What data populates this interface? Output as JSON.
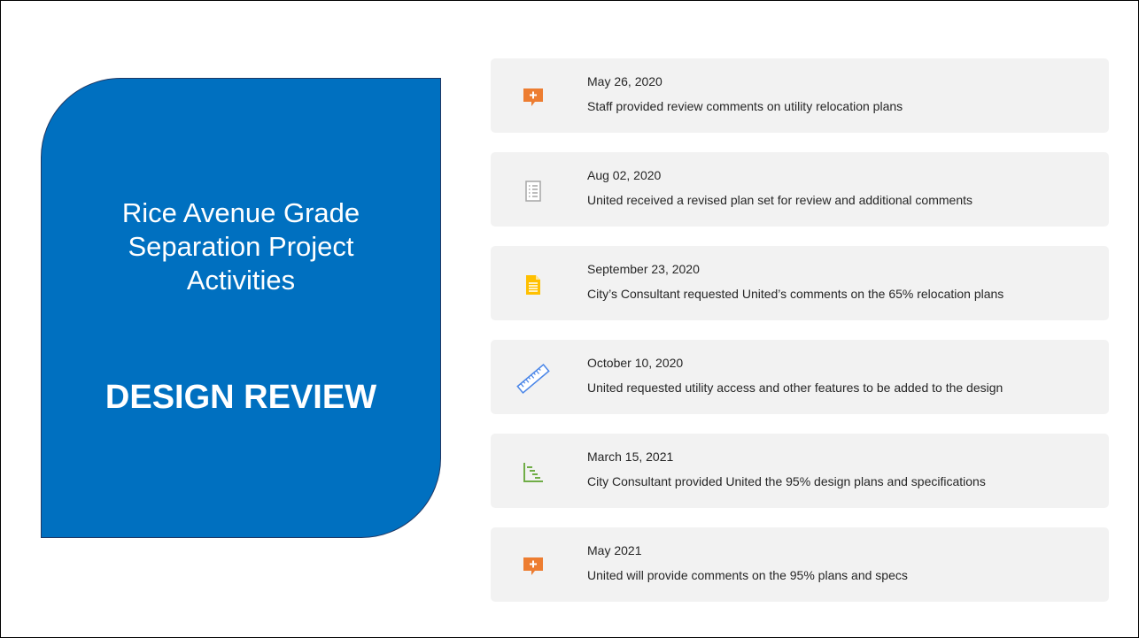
{
  "title": {
    "lines": [
      "Rice Avenue Grade",
      "Separation Project",
      "Activities"
    ],
    "section": "DESIGN REVIEW"
  },
  "colors": {
    "panel": "#0070c0",
    "card": "#f2f2f2",
    "comment_icon": "#ed7d31",
    "document_icon": "#ffc000",
    "ruler_icon": "#4a86e8",
    "gantt_icon": "#70ad47",
    "checklist_icon": "#a6a6a6"
  },
  "timeline": [
    {
      "icon": "comment-add-icon",
      "date": "May 26, 2020",
      "description": "Staff provided review comments on utility relocation plans"
    },
    {
      "icon": "checklist-icon",
      "date": "Aug 02, 2020",
      "description": "United received a revised plan set for review and additional  comments"
    },
    {
      "icon": "document-icon",
      "date": "September 23, 2020",
      "description": "City’s Consultant requested United’s comments on the 65% relocation plans"
    },
    {
      "icon": "ruler-icon",
      "date": "October 10, 2020",
      "description": "United requested utility access and other features to be added to the design"
    },
    {
      "icon": "gantt-chart-icon",
      "date": "March 15, 2021",
      "description": "City Consultant provided United the 95% design plans and specifications"
    },
    {
      "icon": "comment-add-icon",
      "date": "May 2021",
      "description": "United will provide comments on the 95% plans and specs"
    }
  ]
}
